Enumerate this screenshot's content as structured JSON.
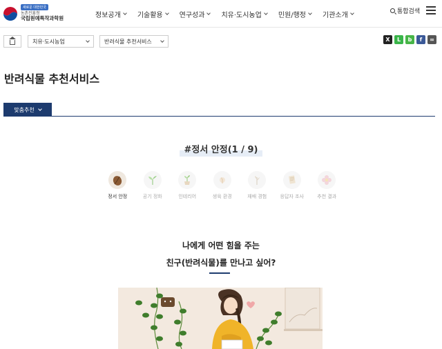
{
  "header": {
    "logo_badge": "새로운 대한민국",
    "logo_sub": "농촌진흥청",
    "logo_main": "국립원예특작과학원",
    "nav": [
      "정보공개",
      "기술활용",
      "연구성과",
      "치유·도시농업",
      "민원/행정",
      "기관소개"
    ],
    "search_label": "통합검색"
  },
  "breadcrumb": {
    "select1": "치유·도시농업",
    "select2": "반려식물 추천서비스"
  },
  "share": [
    {
      "icon": "x-icon",
      "glyph": "X",
      "color": "#222222"
    },
    {
      "icon": "line-icon",
      "glyph": "L",
      "color": "#3ab54a"
    },
    {
      "icon": "band-icon",
      "glyph": "b",
      "color": "#47b547"
    },
    {
      "icon": "facebook-icon",
      "glyph": "f",
      "color": "#3b5998"
    },
    {
      "icon": "link-icon",
      "glyph": "∞",
      "color": "#555555"
    }
  ],
  "page_title": "반려식물 추천서비스",
  "tab_label": "맞춤추천",
  "question_title": "#정서 안정(1 / 9)",
  "steps": [
    {
      "label": "정서 안정",
      "icon": "brown-leaf-icon",
      "active": true
    },
    {
      "label": "공기 정화",
      "icon": "sprout-icon",
      "active": false
    },
    {
      "label": "인테리어",
      "icon": "potted-plant-icon",
      "active": false
    },
    {
      "label": "생육 환경",
      "icon": "growing-plant-icon",
      "active": false
    },
    {
      "label": "재배 경험",
      "icon": "seedling-icon",
      "active": false
    },
    {
      "label": "응답자 조사",
      "icon": "survey-icon",
      "active": false
    },
    {
      "label": "추천 결과",
      "icon": "flower-icon",
      "active": false
    }
  ],
  "message": {
    "line1": "나에게 어떤 힘을 주는",
    "line2": "친구(반려식물)를 만나고 싶어?"
  },
  "colors": {
    "primary": "#1d3b6e",
    "active_step_bg": "#efe8df",
    "illustration_bg": "#f3e9df"
  }
}
